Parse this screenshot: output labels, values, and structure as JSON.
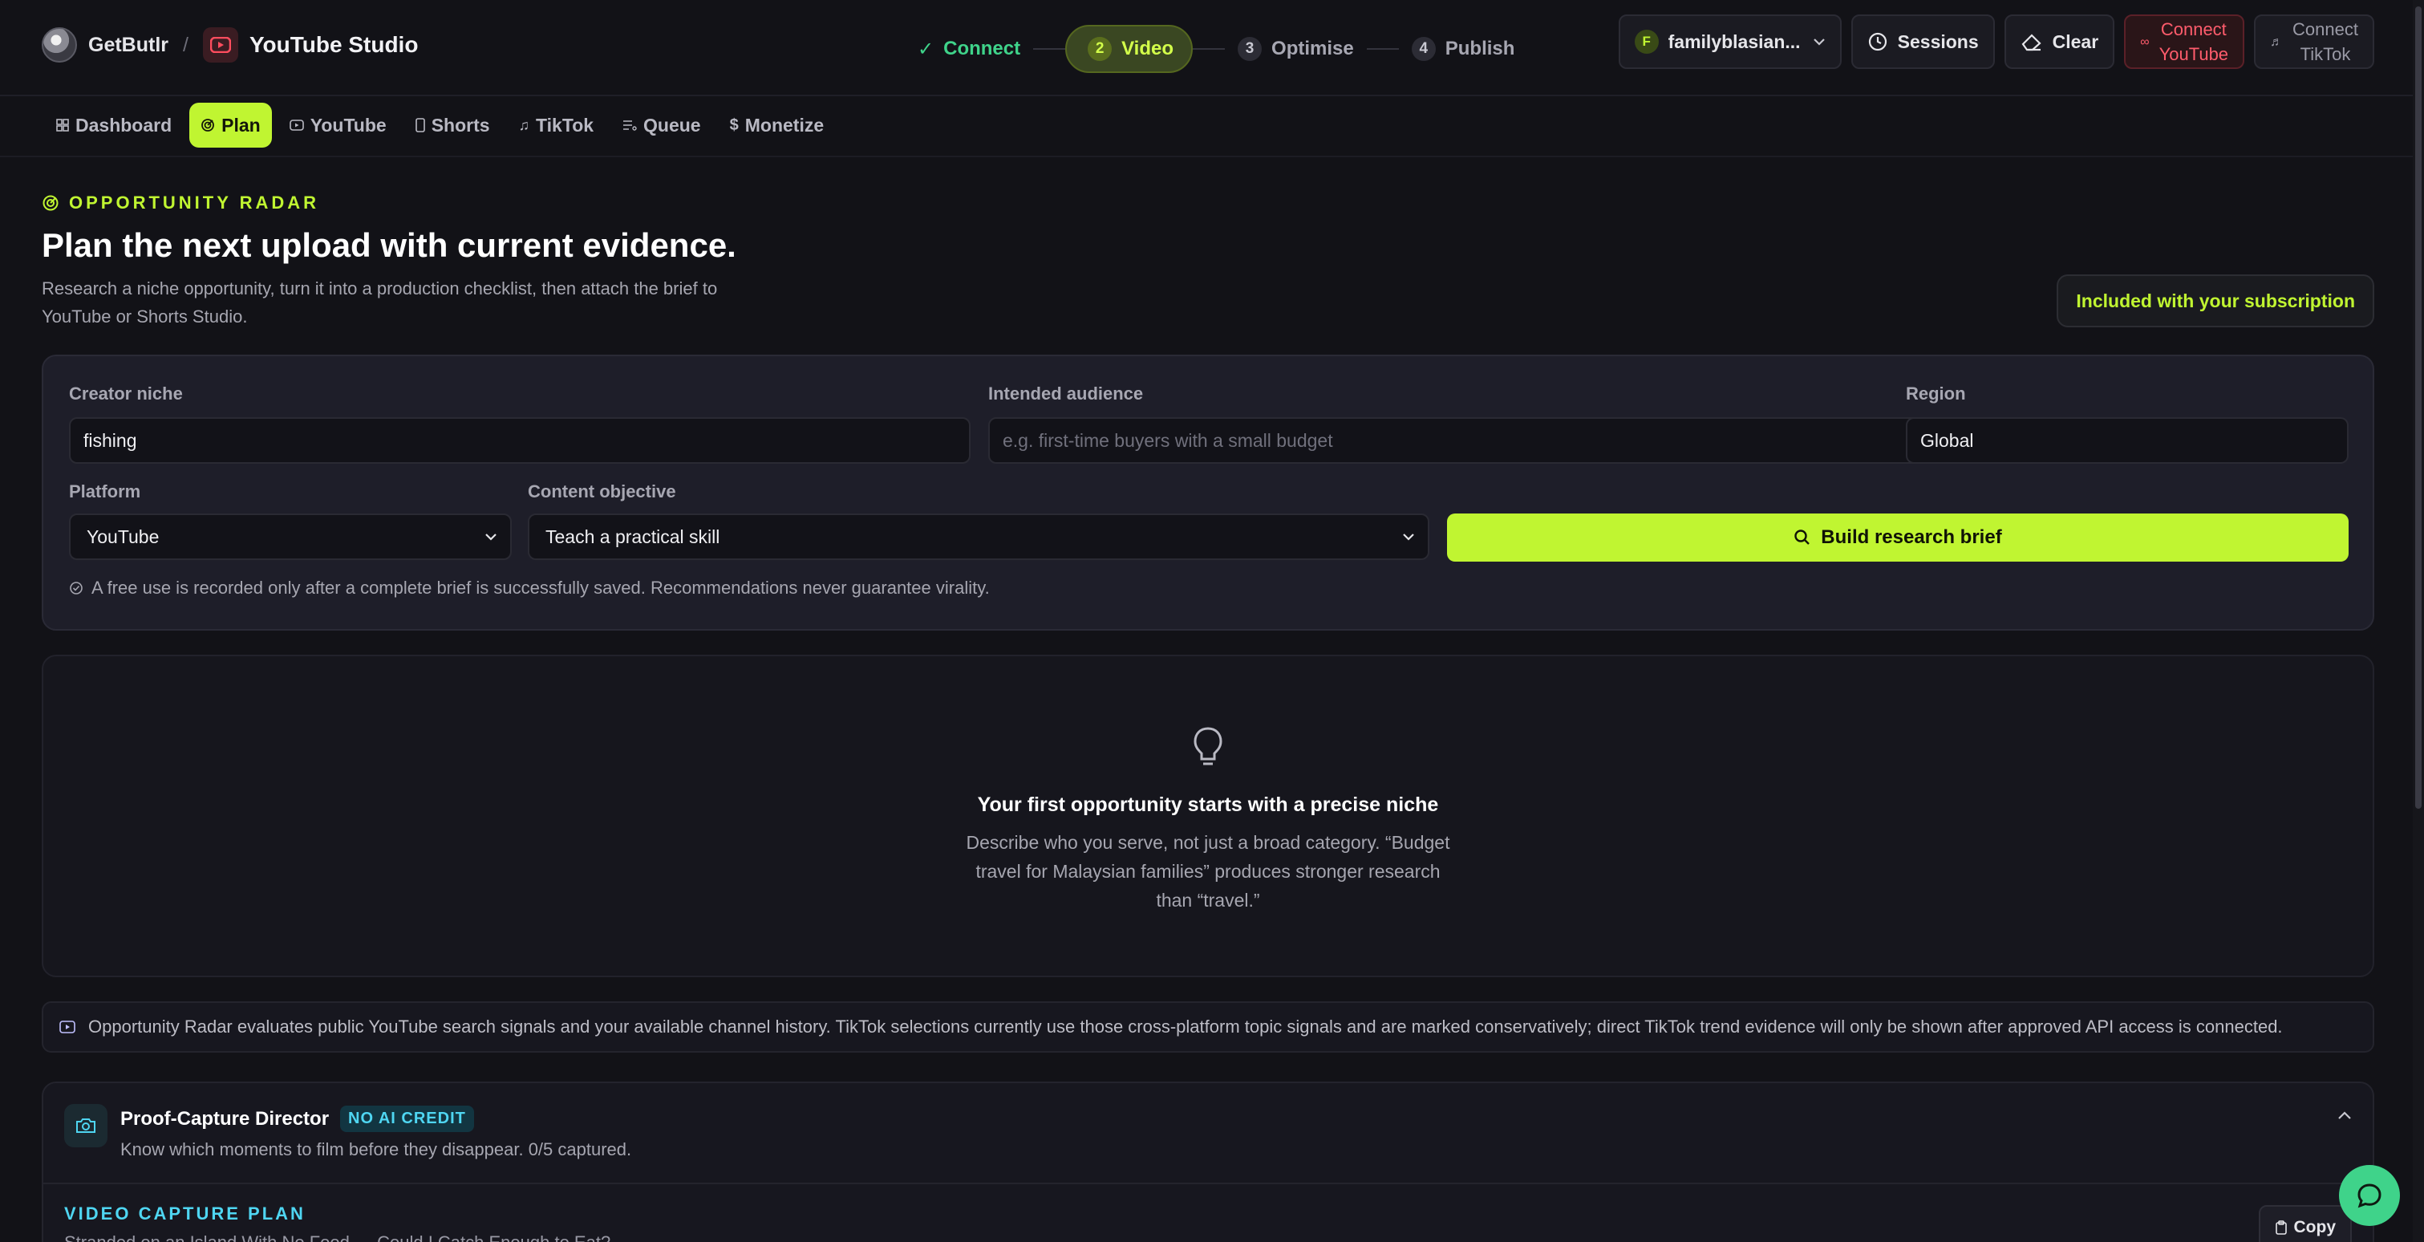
{
  "header": {
    "brand": "GetButlr",
    "separator": "/",
    "studio": "YouTube Studio"
  },
  "stepper": [
    {
      "num": "",
      "label": "Connect",
      "state": "done"
    },
    {
      "num": "2",
      "label": "Video",
      "state": "active"
    },
    {
      "num": "3",
      "label": "Optimise",
      "state": "pending"
    },
    {
      "num": "4",
      "label": "Publish",
      "state": "pending"
    }
  ],
  "account": {
    "initial": "F",
    "name": "familyblasian..."
  },
  "actions": {
    "sessions": "Sessions",
    "clear": "Clear",
    "connect_youtube_1": "Connect",
    "connect_youtube_2": "YouTube",
    "connect_tiktok_1": "Connect",
    "connect_tiktok_2": "TikTok"
  },
  "nav": {
    "tabs": [
      {
        "label": "Dashboard",
        "icon": "grid-icon",
        "active": false
      },
      {
        "label": "Plan",
        "icon": "radar-icon",
        "active": true
      },
      {
        "label": "YouTube",
        "icon": "youtube-icon",
        "active": false
      },
      {
        "label": "Shorts",
        "icon": "phone-icon",
        "active": false
      },
      {
        "label": "TikTok",
        "icon": "music-note-icon",
        "active": false
      },
      {
        "label": "Queue",
        "icon": "list-icon",
        "active": false
      },
      {
        "label": "Monetize",
        "icon": "dollar-icon",
        "active": false
      }
    ]
  },
  "hero": {
    "eyebrow": "OPPORTUNITY RADAR",
    "title": "Plan the next upload with current evidence.",
    "subtitle": "Research a niche opportunity, turn it into a production checklist, then attach the brief to YouTube or Shorts Studio.",
    "badge": "Included with your subscription"
  },
  "form": {
    "niche_label": "Creator niche",
    "niche_value": "fishing",
    "audience_label": "Intended audience",
    "audience_placeholder": "e.g. first-time buyers with a small budget",
    "region_label": "Region",
    "region_value": "Global",
    "platform_label": "Platform",
    "platform_value": "YouTube",
    "objective_label": "Content objective",
    "objective_value": "Teach a practical skill",
    "build_button": "Build research brief",
    "note": "A free use is recorded only after a complete brief is successfully saved. Recommendations never guarantee virality."
  },
  "empty": {
    "title": "Your first opportunity starts with a precise niche",
    "desc": "Describe who you serve, not just a broad category. “Budget travel for Malaysian families” produces stronger research than “travel.”"
  },
  "info": {
    "text": "Opportunity Radar evaluates public YouTube search signals and your available channel history. TikTok selections currently use those cross-platform topic signals and are marked conservatively; direct TikTok trend evidence will only be shown after approved API access is connected."
  },
  "proof": {
    "title": "Proof-Capture Director",
    "badge": "NO AI CREDIT",
    "subtitle": "Know which moments to film before they disappear. 0/5 captured.",
    "capture_heading": "VIDEO CAPTURE PLAN",
    "capture_text": "Stranded on an Island With No Food — Could I Catch Enough to Eat?",
    "copy": "Copy"
  },
  "colors": {
    "accent": "#c0f531",
    "success": "#3fd38a",
    "danger": "#ff5c6c",
    "info": "#4fd6f2",
    "background": "#121217"
  }
}
